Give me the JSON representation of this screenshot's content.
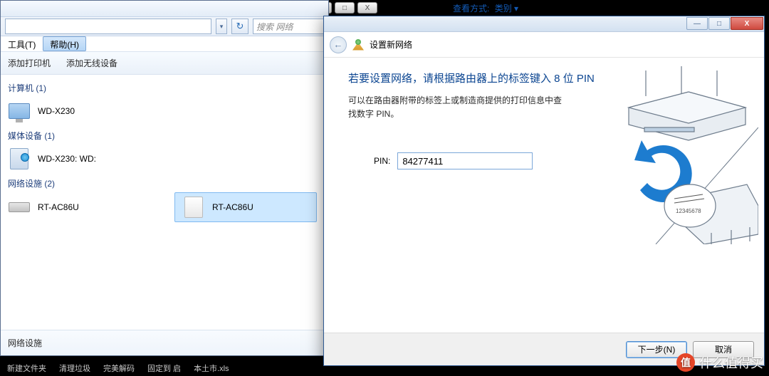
{
  "top": {
    "view_label": "查看方式:",
    "view_value": "类别 ▾",
    "win_min": "—",
    "win_max": "□",
    "win_close": "X"
  },
  "explorer": {
    "search_placeholder": "搜索 网络",
    "menu": {
      "tools": "工具(T)",
      "help": "帮助(H)"
    },
    "toolbar": {
      "add_printer": "添加打印机",
      "add_wireless": "添加无线设备"
    },
    "groups": {
      "computers": {
        "label": "计算机 (1)",
        "item1": "WD-X230"
      },
      "media": {
        "label": "媒体设备 (1)",
        "item1": "WD-X230: WD:"
      },
      "network": {
        "label": "网络设施 (2)",
        "item1": "RT-AC86U",
        "item2": "RT-AC86U"
      }
    },
    "status": "网络设施"
  },
  "dialog": {
    "header_title": "设置新网络",
    "title": "若要设置网络，请根据路由器上的标签键入 8 位 PIN",
    "desc": "可以在路由器附带的标签上或制造商提供的打印信息中查找数字 PIN。",
    "pin_label": "PIN:",
    "pin_value": "84277411",
    "next_btn": "下一步(N)",
    "cancel_btn": "取消",
    "min": "—",
    "max": "□",
    "close": "X",
    "back": "←"
  },
  "watermark": {
    "badge": "值",
    "text": "什么值得买"
  },
  "taskbar": {
    "t1": "新建文件夹",
    "t2": "清理垃圾",
    "t3": "完美解码",
    "t4": "固定到 启",
    "t5": "本土市.xls"
  }
}
